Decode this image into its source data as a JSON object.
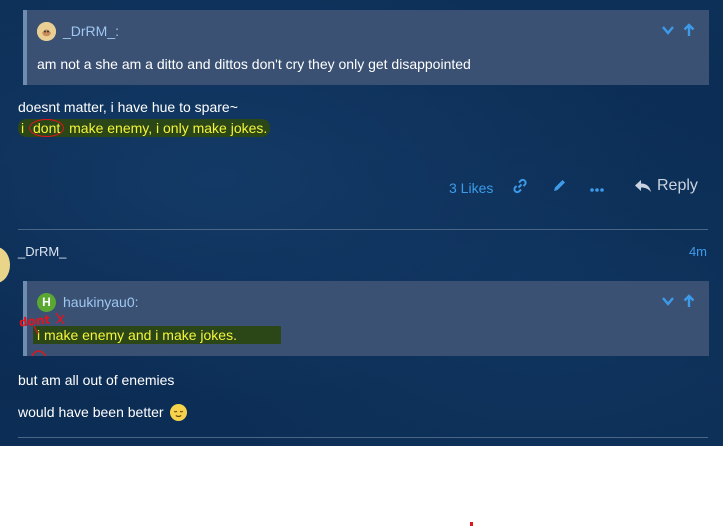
{
  "quote1": {
    "author": "_DrRM_:",
    "text": "am not a she am a ditto and dittos don't cry they only get disappointed"
  },
  "post1": {
    "line1": "doesnt matter, i have hue to spare~",
    "line2_prefix": "i ",
    "line2_circled": "dont",
    "line2_rest": " make enemy, i only make jokes."
  },
  "actions": {
    "likes": "3 Likes",
    "reply": "Reply"
  },
  "post2": {
    "author": "_DrRM_",
    "time": "4m",
    "quote": {
      "avatar_letter": "H",
      "author": "haukinyau0:",
      "text": "i make enemy and i make jokes.",
      "annotation": "dont"
    },
    "line1": "but am all out of enemies",
    "line2": "would have been better"
  },
  "colors": {
    "link": "#3d9be9",
    "highlight_bg": "#2b4617",
    "highlight_text": "#f5f53a",
    "annotation": "#e0151d",
    "avatar_h": "#5aa832"
  },
  "icons": [
    "ditto-avatar-icon",
    "chevron-down-icon",
    "arrow-up-icon",
    "link-icon",
    "pencil-icon",
    "more-icon",
    "reply-icon",
    "relieved-face-emoji"
  ]
}
